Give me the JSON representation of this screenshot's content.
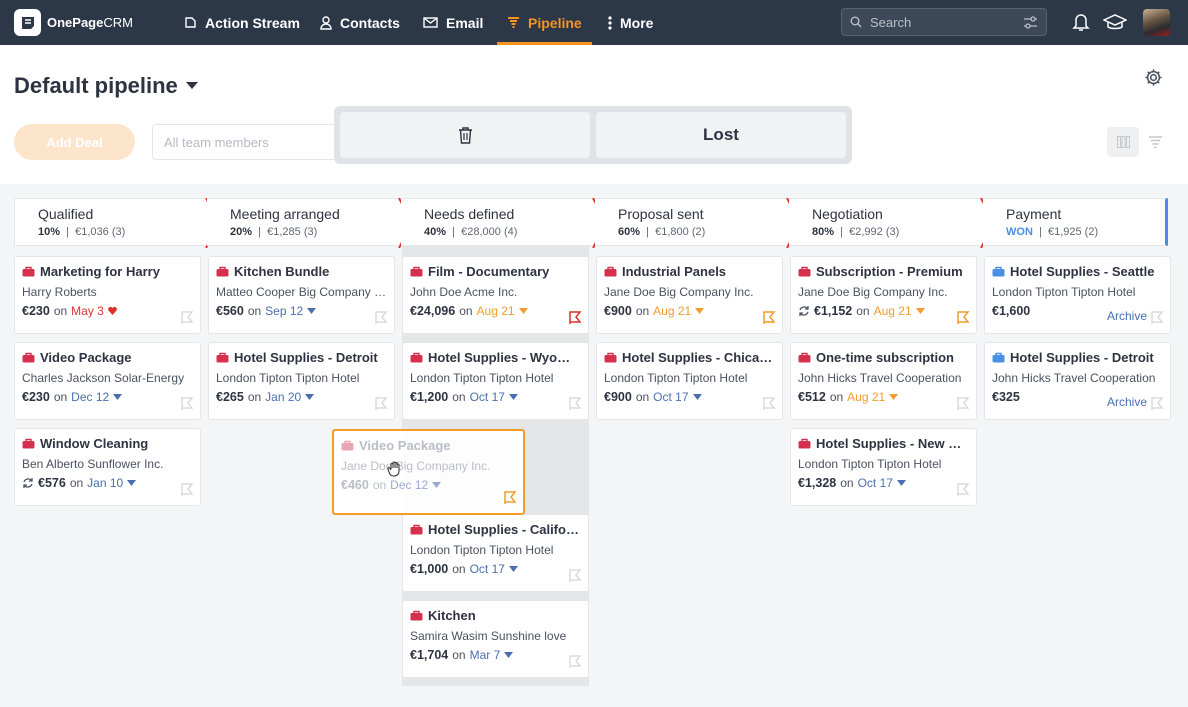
{
  "nav": {
    "logo_bold": "OnePage",
    "logo_light": "CRM",
    "items": [
      {
        "label": "Action Stream",
        "icon": "action-stream-icon"
      },
      {
        "label": "Contacts",
        "icon": "contacts-icon"
      },
      {
        "label": "Email",
        "icon": "email-icon"
      },
      {
        "label": "Pipeline",
        "icon": "pipeline-icon",
        "active": true
      },
      {
        "label": "More",
        "icon": "more-vertical-icon"
      }
    ],
    "search_placeholder": "Search"
  },
  "header": {
    "title": "Default pipeline",
    "add_deal_label": "Add Deal",
    "team_filter_placeholder": "All team members",
    "drop_lost_label": "Lost"
  },
  "stages": [
    {
      "name": "Qualified",
      "percent": "10%",
      "summary": "€1,036 (3)"
    },
    {
      "name": "Meeting arranged",
      "percent": "20%",
      "summary": "€1,285 (3)"
    },
    {
      "name": "Needs defined",
      "percent": "40%",
      "summary": "€28,000 (4)"
    },
    {
      "name": "Proposal sent",
      "percent": "60%",
      "summary": "€1,800 (2)"
    },
    {
      "name": "Negotiation",
      "percent": "80%",
      "summary": "€2,992 (3)"
    },
    {
      "name": "Payment",
      "percent": "WON",
      "summary": "€1,925 (2)"
    }
  ],
  "on_label": "on",
  "archive_label": "Archive",
  "cards": [
    {
      "title": "Marketing for Harry",
      "contact": "Harry Roberts",
      "amount": "€230",
      "date": "May 3"
    },
    {
      "title": "Video Package",
      "contact": "Charles Jackson Solar-Energy",
      "amount": "€230",
      "date": "Dec 12"
    },
    {
      "title": "Window Cleaning",
      "contact": "Ben Alberto Sunflower Inc.",
      "amount": "€576",
      "date": "Jan 10"
    },
    {
      "title": "Kitchen Bundle",
      "contact": "Matteo Cooper Big Company Inc.",
      "amount": "€560",
      "date": "Sep 12"
    },
    {
      "title": "Hotel Supplies - Detroit",
      "contact": "London Tipton Tipton Hotel",
      "amount": "€265",
      "date": "Jan 20"
    },
    {
      "title": "Film - Documentary",
      "contact": "John Doe Acme Inc.",
      "amount": "€24,096",
      "date": "Aug 21"
    },
    {
      "title": "Hotel Supplies - Wyoming",
      "contact": "London Tipton Tipton Hotel",
      "amount": "€1,200",
      "date": "Oct 17"
    },
    {
      "title": "Hotel Supplies - California",
      "contact": "London Tipton Tipton Hotel",
      "amount": "€1,000",
      "date": "Oct 17"
    },
    {
      "title": "Kitchen",
      "contact": "Samira Wasim Sunshine love",
      "amount": "€1,704",
      "date": "Mar 7"
    },
    {
      "title": "Industrial Panels",
      "contact": "Jane Doe Big Company Inc.",
      "amount": "€900",
      "date": "Aug 21"
    },
    {
      "title": "Hotel Supplies - Chicago",
      "contact": "London Tipton Tipton Hotel",
      "amount": "€900",
      "date": "Oct 17"
    },
    {
      "title": "Subscription - Premium",
      "contact": "Jane Doe Big Company Inc.",
      "amount": "€1,152",
      "date": "Aug 21"
    },
    {
      "title": "One-time subscription",
      "contact": "John Hicks Travel Cooperation",
      "amount": "€512",
      "date": "Aug 21"
    },
    {
      "title": "Hotel Supplies - New Hampshire",
      "contact": "London Tipton Tipton Hotel",
      "amount": "€1,328",
      "date": "Oct 17"
    },
    {
      "title": "Hotel Supplies - Seattle",
      "contact": "London Tipton Tipton Hotel",
      "amount": "€1,600"
    },
    {
      "title": "Hotel Supplies - Detroit",
      "contact": "John Hicks Travel Cooperation",
      "amount": "€325"
    }
  ],
  "dragging_card": {
    "title": "Video Package",
    "contact": "Jane Doe Big Company Inc.",
    "amount": "€460",
    "date": "Dec 12"
  },
  "colors": {
    "nav_bg": "#2c3848",
    "accent": "#f7931e",
    "stage_arrow": "#d9342b",
    "won": "#4a90e2",
    "bag_red": "#d6304f",
    "bag_blue": "#4a90e2"
  }
}
